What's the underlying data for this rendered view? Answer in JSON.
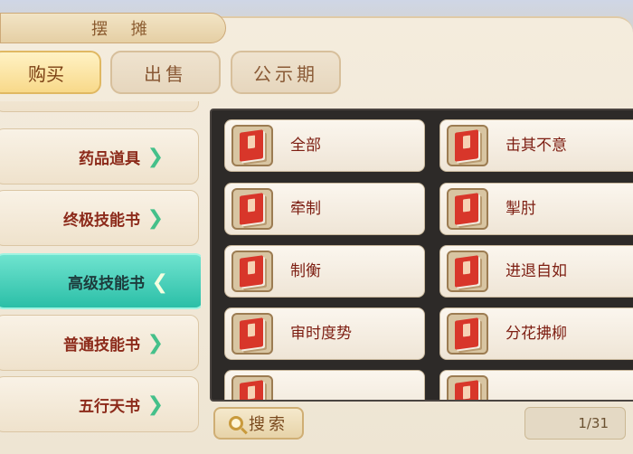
{
  "window": {
    "title": "摆 摊"
  },
  "tabs": [
    {
      "label": "购买"
    },
    {
      "label": "出售"
    },
    {
      "label": "公示期"
    }
  ],
  "categories": [
    {
      "label": "药品道具"
    },
    {
      "label": "终极技能书"
    },
    {
      "label": "高级技能书"
    },
    {
      "label": "普通技能书"
    },
    {
      "label": "五行天书"
    }
  ],
  "active_category": "高级技能书",
  "items": [
    {
      "name": "全部",
      "icon": "skill-book-icon"
    },
    {
      "name": "击其不意",
      "icon": "skill-book-icon"
    },
    {
      "name": "牵制",
      "icon": "skill-book-icon"
    },
    {
      "name": "掣肘",
      "icon": "skill-book-icon"
    },
    {
      "name": "制衡",
      "icon": "skill-book-icon"
    },
    {
      "name": "进退自如",
      "icon": "skill-book-icon"
    },
    {
      "name": "审时度势",
      "icon": "skill-book-icon"
    },
    {
      "name": "分花拂柳",
      "icon": "skill-book-icon"
    }
  ],
  "search": {
    "label": "搜索"
  },
  "pagination": {
    "text": "1/31"
  },
  "colors": {
    "active_category": "#2bbfa7",
    "item_text": "#7d1e12"
  }
}
